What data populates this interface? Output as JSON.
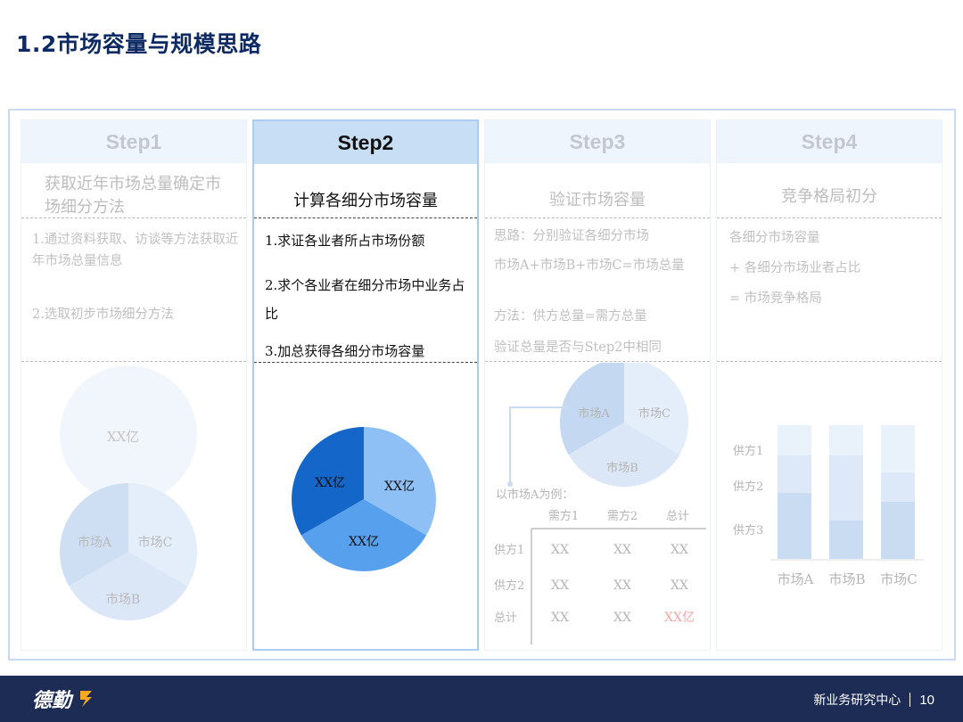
{
  "title": "1.2市场容量与规模思路",
  "steps": [
    {
      "header": "Step1",
      "subtitle": "获取近年市场总量确定市场细分方法",
      "items": [
        "1.通过资料获取、访谈等方法获取近年市场总量信息",
        "2.选取初步市场细分方法"
      ],
      "circle_label": "XX亿",
      "pie_labels": [
        "市场A",
        "市场C",
        "市场B"
      ]
    },
    {
      "header": "Step2",
      "subtitle": "计算各细分市场容量",
      "items": [
        "1.求证各业者所占市场份额",
        "2.求个各业者在细分市场中业务占比",
        "3.加总获得各细分市场容量"
      ],
      "pie_labels": [
        "XX亿",
        "XX亿",
        "XX亿"
      ]
    },
    {
      "header": "Step3",
      "subtitle": "验证市场容量",
      "items": [
        "思路：分别验证各细分市场",
        "市场A+市场B+市场C=市场总量",
        "方法：供方总量=需方总量",
        "验证总量是否与Step2中相同"
      ],
      "pie_labels": [
        "市场A",
        "市场C",
        "市场B"
      ],
      "example_label": "以市场A为例：",
      "table": {
        "columns": [
          "需方1",
          "需方2",
          "总计"
        ],
        "rows": [
          {
            "label": "供方1",
            "cells": [
              "XX",
              "XX",
              "XX"
            ]
          },
          {
            "label": "供方2",
            "cells": [
              "XX",
              "XX",
              "XX"
            ]
          },
          {
            "label": "总计",
            "cells": [
              "XX",
              "XX",
              "XX亿"
            ]
          }
        ]
      }
    },
    {
      "header": "Step4",
      "subtitle": "竞争格局初分",
      "items": [
        "各细分市场容量",
        "+ 各细分市场业者占比",
        "= 市场竞争格局"
      ],
      "bar_series": [
        "供方1",
        "供方2",
        "供方3"
      ],
      "bar_categories": [
        "市场A",
        "市场B",
        "市场C"
      ]
    }
  ],
  "footer": {
    "logo": "德勤",
    "center": "新业务研究中心",
    "page": "10"
  },
  "colors": {
    "title": "#0e2a63",
    "footer_bg": "#1c2c55",
    "active_header": "#c7def5",
    "dim_header": "#eff5fc",
    "highlight_red": "#f2a6a6"
  }
}
